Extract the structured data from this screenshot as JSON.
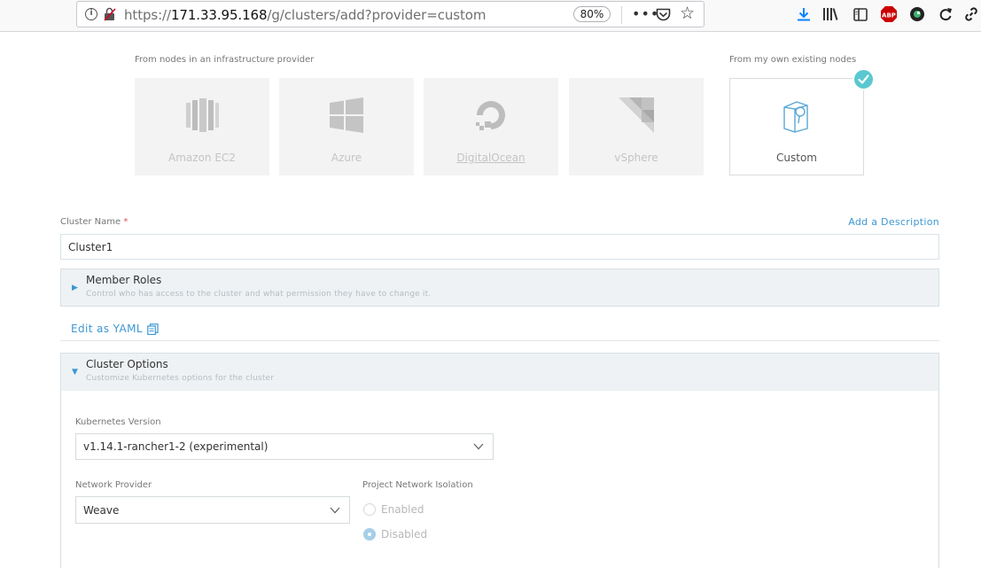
{
  "browser": {
    "url_prefix": "https://",
    "url_host": "171.33.95.168",
    "url_path": "/g/clusters/add?provider=custom",
    "zoom": "80%",
    "info_icon": "info-icon",
    "lock_icon": "insecure-lock-icon",
    "menu_dots": "•••",
    "icons": [
      "download-icon",
      "library-icon",
      "sidebar-icon",
      "adblock-icon",
      "extension-icon",
      "reload-icon",
      "link-icon"
    ]
  },
  "providers": {
    "infra_label": "From nodes in an infrastructure provider",
    "own_label": "From my own existing nodes",
    "items": [
      {
        "label": "Amazon EC2",
        "icon": "amazon-ec2-icon",
        "selected": false
      },
      {
        "label": "Azure",
        "icon": "azure-icon",
        "selected": false
      },
      {
        "label": "DigitalOcean",
        "icon": "digitalocean-icon",
        "selected": false
      },
      {
        "label": "vSphere",
        "icon": "vsphere-icon",
        "selected": false
      }
    ],
    "custom": {
      "label": "Custom",
      "icon": "custom-nodes-icon",
      "selected": true
    }
  },
  "cluster_name": {
    "label": "Cluster Name",
    "required_mark": "*",
    "value": "Cluster1",
    "add_description": "Add a Description"
  },
  "member_roles": {
    "title": "Member Roles",
    "subtitle": "Control who has access to the cluster and what permission they have to change it.",
    "expanded": false
  },
  "edit_yaml": {
    "label": "Edit as YAML",
    "icon": "copy-icon"
  },
  "cluster_options": {
    "title": "Cluster Options",
    "subtitle": "Customize Kubernetes options for the cluster",
    "expanded": true,
    "kubernetes_version": {
      "label": "Kubernetes Version",
      "value": "v1.14.1-rancher1-2 (experimental)"
    },
    "network_provider": {
      "label": "Network Provider",
      "value": "Weave"
    },
    "project_network_isolation": {
      "label": "Project Network Isolation",
      "options": [
        {
          "label": "Enabled",
          "checked": false
        },
        {
          "label": "Disabled",
          "checked": true
        }
      ]
    }
  },
  "colors": {
    "accent": "#3d98d3",
    "check_badge": "#5ac8d0",
    "accordion_bg": "#eef2f4"
  }
}
